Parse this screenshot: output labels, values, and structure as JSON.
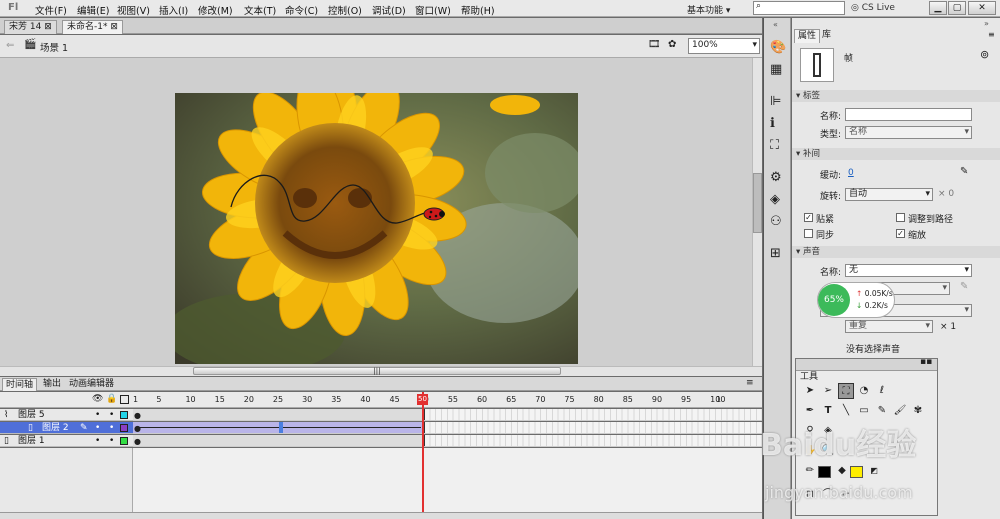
{
  "app": {
    "logo": "Fl",
    "workspace": "基本功能",
    "search_placeholder": "",
    "cslive": "CS Live"
  },
  "menus": [
    "文件(F)",
    "编辑(E)",
    "视图(V)",
    "插入(I)",
    "修改(M)",
    "文本(T)",
    "命令(C)",
    "控制(O)",
    "调试(D)",
    "窗口(W)",
    "帮助(H)"
  ],
  "doc_tabs": [
    "宋芳 14",
    "未命名-1*"
  ],
  "scene": "场景 1",
  "zoom": "100%",
  "timeline": {
    "tabs": [
      "时间轴",
      "输出",
      "动画编辑器"
    ],
    "frame_numbers": [
      "1",
      "5",
      "10",
      "15",
      "20",
      "25",
      "30",
      "35",
      "40",
      "45",
      "50",
      "55",
      "60",
      "65",
      "70",
      "75",
      "80",
      "85",
      "90",
      "95",
      "100",
      "1"
    ],
    "current_frame": "50",
    "layers": [
      {
        "name": "图层 5",
        "color": "#22d4e8",
        "type": "guide"
      },
      {
        "name": "图层 2",
        "color": "#8a3ec4",
        "type": "guided",
        "selected": true
      },
      {
        "name": "图层 1",
        "color": "#33dd44",
        "type": "normal"
      }
    ]
  },
  "properties": {
    "tabs": [
      "属性",
      "库"
    ],
    "type_label": "帧",
    "label_section": "标签",
    "name_label": "名称:",
    "type_field_label": "类型:",
    "type_value": "名称",
    "tween_section": "补间",
    "ease_label": "缓动:",
    "ease_value": "0",
    "rotate_label": "旋转:",
    "rotate_value": "自动",
    "rotate_mult": "× 0",
    "snap": "贴紧",
    "orient": "调整到路径",
    "sync": "同步",
    "scale": "缩放",
    "sound_section": "声音",
    "sound_name_label": "名称:",
    "sound_name_value": "无",
    "repeat_value": "重复",
    "repeat_count": "× 1",
    "no_sound": "没有选择声音"
  },
  "speed": {
    "percent": "65%",
    "up": "0.05K/s",
    "down": "0.2K/s"
  },
  "tools": {
    "title": "工具"
  },
  "watermark": {
    "line1": "Baidu经验",
    "line2": "jingyan.baidu.com"
  }
}
